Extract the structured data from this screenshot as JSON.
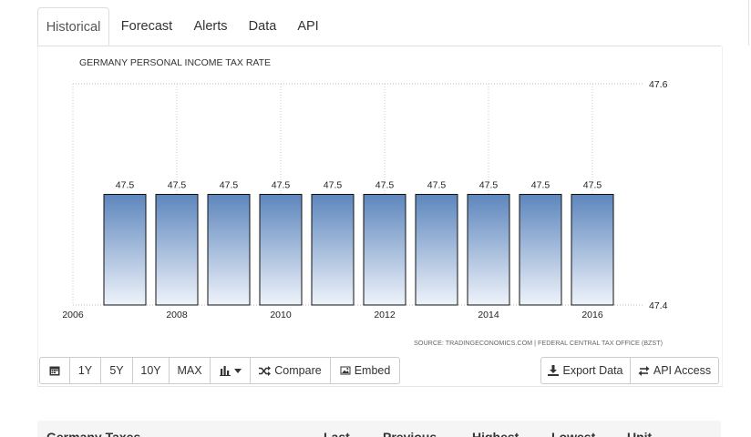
{
  "tabs": [
    "Historical",
    "Forecast",
    "Alerts",
    "Data",
    "API"
  ],
  "chart_data": {
    "type": "bar",
    "title": "GERMANY PERSONAL INCOME TAX RATE",
    "categories": [
      "2007",
      "2008",
      "2009",
      "2010",
      "2011",
      "2012",
      "2013",
      "2014",
      "2015",
      "2016"
    ],
    "values": [
      47.5,
      47.5,
      47.5,
      47.5,
      47.5,
      47.5,
      47.5,
      47.5,
      47.5,
      47.5
    ],
    "data_labels": [
      "47.5",
      "47.5",
      "47.5",
      "47.5",
      "47.5",
      "47.5",
      "47.5",
      "47.5",
      "47.5",
      "47.5"
    ],
    "x_ticks": [
      "2006",
      "2008",
      "2010",
      "2012",
      "2014",
      "2016"
    ],
    "y_ticks": [
      "47.6",
      "47.4"
    ],
    "ylim": [
      47.4,
      47.6
    ],
    "y_axis_position": "right",
    "grid": true,
    "bar_gradient": [
      "#5d86bd",
      "#eef3fa"
    ],
    "source": "SOURCE: TRADINGECONOMICS.COM  |  FEDERAL CENTRAL TAX OFFICE (BZST)"
  },
  "toolbar": {
    "calendar_icon": "calendar-icon",
    "ranges": [
      "1Y",
      "5Y",
      "10Y",
      "MAX"
    ],
    "chart_type_icon": "bar-chart-icon",
    "compare_label": "Compare",
    "embed_label": "Embed",
    "export_label": "Export Data",
    "api_label": "API Access"
  },
  "table": {
    "headers": [
      "Germany Taxes",
      "Last",
      "Previous",
      "Highest",
      "Lowest",
      "Unit"
    ]
  }
}
